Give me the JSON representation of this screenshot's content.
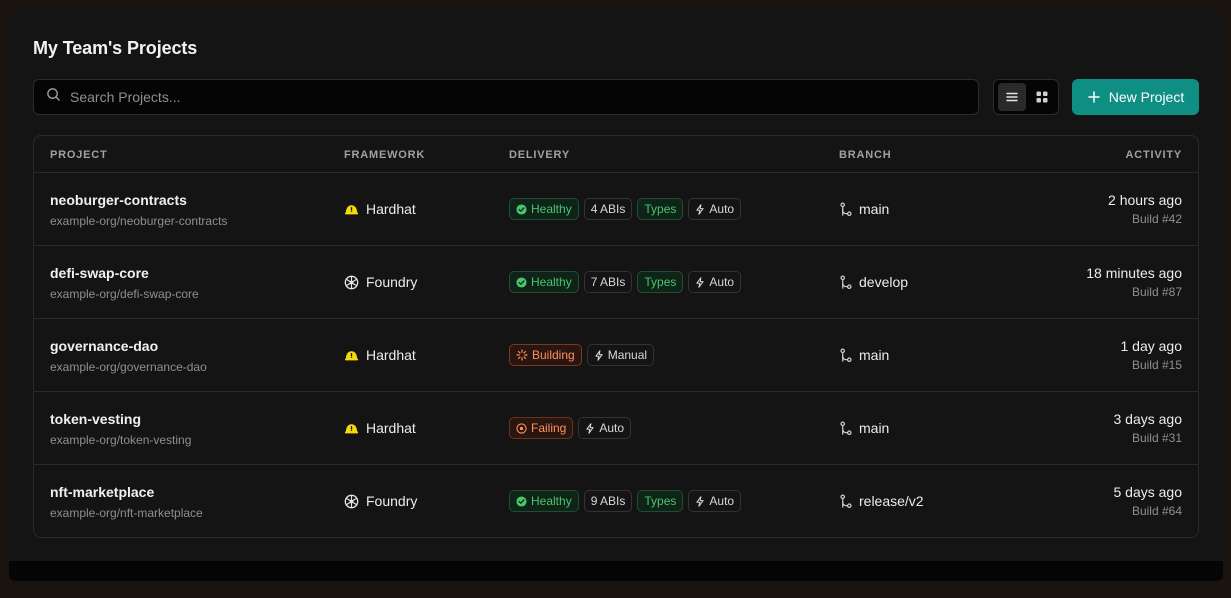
{
  "header": {
    "title": "My Team's Projects"
  },
  "search": {
    "placeholder": "Search Projects..."
  },
  "toolbar": {
    "new_project_label": "New Project",
    "view_mode": "list"
  },
  "colors": {
    "accent": "#0f8f84",
    "healthy": "#4cc36d",
    "warning": "#ff8f5c",
    "hardhat": "#f5d90a"
  },
  "table": {
    "columns": [
      "PROJECT",
      "FRAMEWORK",
      "DELIVERY",
      "BRANCH",
      "ACTIVITY"
    ],
    "rows": [
      {
        "name": "neoburger-contracts",
        "repo": "example-org/neoburger-contracts",
        "framework": "Hardhat",
        "framework_icon": "hardhat-icon",
        "badges": [
          {
            "type": "healthy",
            "label": "Healthy"
          },
          {
            "type": "plain",
            "label": "4 ABIs"
          },
          {
            "type": "types",
            "label": "Types"
          },
          {
            "type": "auto",
            "label": "Auto"
          }
        ],
        "branch": "main",
        "activity": "2 hours ago",
        "build": "Build #42"
      },
      {
        "name": "defi-swap-core",
        "repo": "example-org/defi-swap-core",
        "framework": "Foundry",
        "framework_icon": "foundry-icon",
        "badges": [
          {
            "type": "healthy",
            "label": "Healthy"
          },
          {
            "type": "plain",
            "label": "7 ABIs"
          },
          {
            "type": "types",
            "label": "Types"
          },
          {
            "type": "auto",
            "label": "Auto"
          }
        ],
        "branch": "develop",
        "activity": "18 minutes ago",
        "build": "Build #87"
      },
      {
        "name": "governance-dao",
        "repo": "example-org/governance-dao",
        "framework": "Hardhat",
        "framework_icon": "hardhat-icon",
        "badges": [
          {
            "type": "building",
            "label": "Building"
          },
          {
            "type": "auto",
            "label": "Manual"
          }
        ],
        "branch": "main",
        "activity": "1 day ago",
        "build": "Build #15"
      },
      {
        "name": "token-vesting",
        "repo": "example-org/token-vesting",
        "framework": "Hardhat",
        "framework_icon": "hardhat-icon",
        "badges": [
          {
            "type": "failing",
            "label": "Failing"
          },
          {
            "type": "auto",
            "label": "Auto"
          }
        ],
        "branch": "main",
        "activity": "3 days ago",
        "build": "Build #31"
      },
      {
        "name": "nft-marketplace",
        "repo": "example-org/nft-marketplace",
        "framework": "Foundry",
        "framework_icon": "foundry-icon",
        "badges": [
          {
            "type": "healthy",
            "label": "Healthy"
          },
          {
            "type": "plain",
            "label": "9 ABIs"
          },
          {
            "type": "types",
            "label": "Types"
          },
          {
            "type": "auto",
            "label": "Auto"
          }
        ],
        "branch": "release/v2",
        "activity": "5 days ago",
        "build": "Build #64"
      }
    ]
  }
}
